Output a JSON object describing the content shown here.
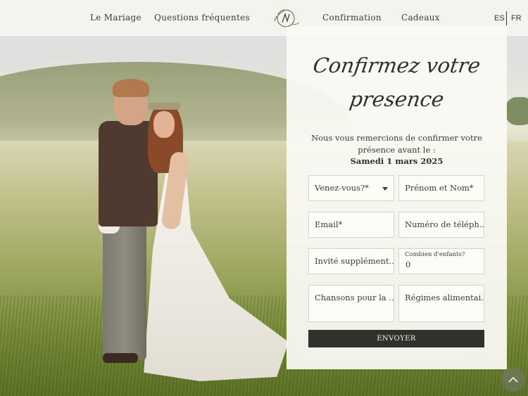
{
  "nav": {
    "left": [
      "Le Mariage",
      "Questions fréquentes"
    ],
    "right": [
      "Confirmation",
      "Cadeaux"
    ],
    "languages": [
      "ES",
      "FR"
    ]
  },
  "logo": {
    "icon": "monogram-wreath-logo"
  },
  "form": {
    "title_line1": "Confirmez votre",
    "title_line2": "presence",
    "intro": "Nous vous remercions de confirmer votre présence avant le :",
    "deadline": "Samedi 1 mars 2025",
    "fields": {
      "attending": {
        "placeholder": "Venez-vous?*"
      },
      "name": {
        "placeholder": "Prénom et Nom*"
      },
      "email": {
        "placeholder": "Email*"
      },
      "phone": {
        "placeholder": "Numéro de téléph..."
      },
      "guests": {
        "placeholder": "Invité supplément..."
      },
      "children": {
        "label": "Combien d'enfants?",
        "value": "0"
      },
      "songs": {
        "placeholder": "Chansons pour la ..."
      },
      "diet": {
        "placeholder": "Régimes alimentai..."
      }
    },
    "submit_label": "ENVOYER"
  },
  "scroll_top": {
    "icon": "chevron-up-icon"
  },
  "colors": {
    "button": "#2f312c",
    "card": "#faf9f4",
    "text": "#3b3a34"
  }
}
